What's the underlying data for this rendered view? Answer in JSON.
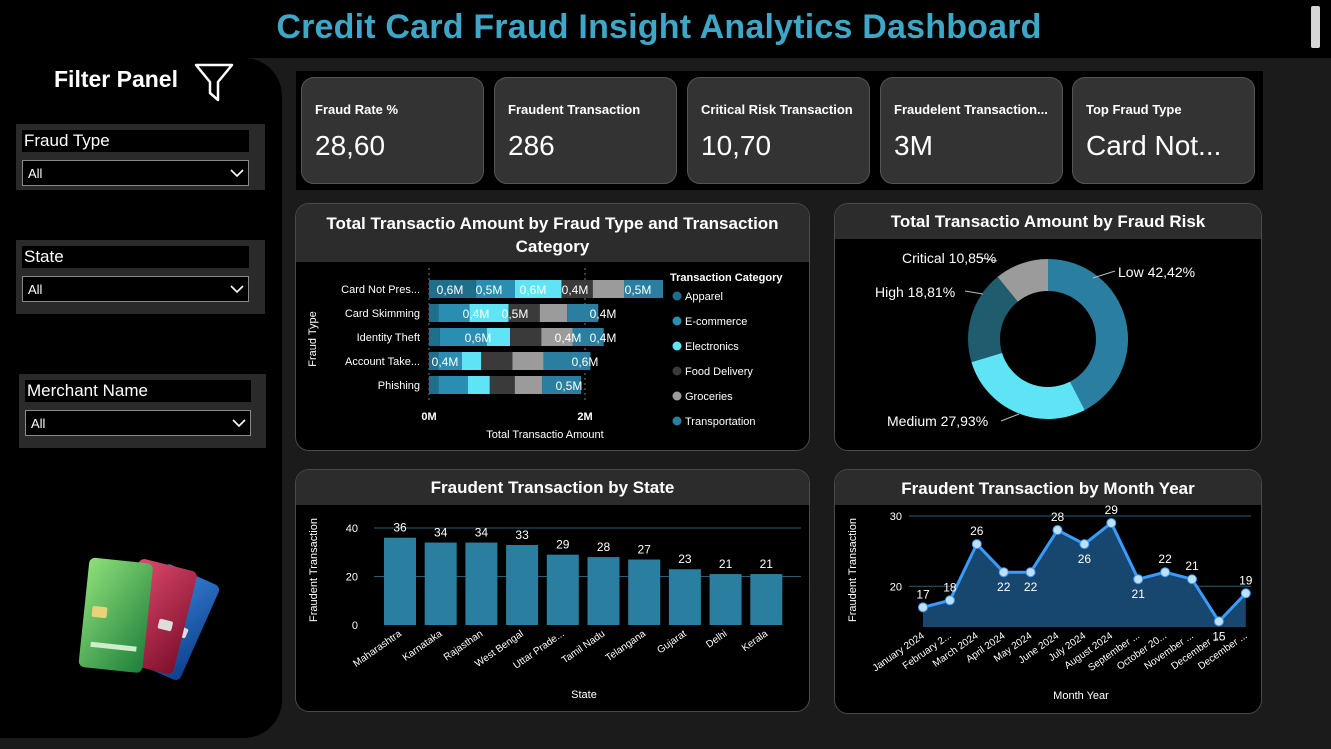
{
  "header": {
    "title": "Credit Card Fraud Insight Analytics Dashboard"
  },
  "filter_panel": {
    "title": "Filter Panel",
    "slicers": [
      {
        "label": "Fraud Type",
        "value": "All"
      },
      {
        "label": "State",
        "value": "All"
      },
      {
        "label": "Merchant Name",
        "value": "All"
      }
    ]
  },
  "kpis": [
    {
      "label": "Fraud Rate %",
      "value": "28,60"
    },
    {
      "label": "Fraudent Transaction",
      "value": "286"
    },
    {
      "label": "Critical Risk Transaction",
      "value": "10,70"
    },
    {
      "label": "Fraudelent Transaction...",
      "value": "3M"
    },
    {
      "label": "Top Fraud Type",
      "value": "Card Not..."
    }
  ],
  "stacked_chart": {
    "title_line1": "Total Transactio Amount by Fraud Type and Transaction",
    "title_line2": "Category",
    "ylabel": "Fraud Type",
    "xlabel": "Total Transactio Amount",
    "ticks": [
      "0M",
      "2M"
    ],
    "legend_title": "Transaction Category",
    "segment_labels": {
      "card_not_present": [
        "0,6M",
        "0,5M",
        "0,6M",
        "0,4M",
        "0,5M"
      ],
      "card_skimming": [
        "0,4M",
        "0,5M",
        "0,4M"
      ],
      "identity_theft": [
        "0,6M",
        "0,4M",
        "0,4M"
      ],
      "account_takeover": [
        "0,4M",
        "0,6M"
      ],
      "phishing": [
        "0,5M"
      ]
    }
  },
  "donut_chart": {
    "title": "Total Transactio Amount by Fraud Risk",
    "labels": [
      "Low 42,42%",
      "Medium 27,93%",
      "High 18,81%",
      "Critical 10,85%"
    ]
  },
  "state_chart": {
    "title": "Fraudent Transaction by State",
    "ylabel": "Fraudent Transaction",
    "xlabel": "State"
  },
  "month_chart": {
    "title": "Fraudent Transaction by Month Year",
    "ylabel": "Fraudent Transaction",
    "xlabel": "Month Year"
  },
  "colors": {
    "title": "#3ea6c6",
    "apparel": "#1f6f8b",
    "ecommerce": "#2a8db2",
    "electronics": "#5ee4f4",
    "food_delivery": "#3a3a3a",
    "groceries": "#9b9b9b",
    "transportation": "#2a7fa0",
    "risk_low": "#2a7fa0",
    "risk_medium": "#5ee4f4",
    "risk_high": "#1f5c6e",
    "risk_critical": "#9b9b9b",
    "state_bar": "#2a7fa0",
    "line": "#3a9bff",
    "area": "#17466e"
  },
  "chart_data": [
    {
      "type": "bar",
      "orientation": "horizontal-stacked",
      "title": "Total Transactio Amount by Fraud Type and Transaction Category",
      "xlabel": "Total Transactio Amount",
      "ylabel": "Fraud Type",
      "categories": [
        "Card Not Pres...",
        "Card Skimming",
        "Identity Theft",
        "Account Take...",
        "Phishing"
      ],
      "series": [
        {
          "name": "Apparel",
          "values": [
            0.6,
            0.12,
            0.14,
            0.12,
            0.12
          ]
        },
        {
          "name": "E-commerce",
          "values": [
            0.5,
            0.4,
            0.6,
            0.3,
            0.38
          ]
        },
        {
          "name": "Electronics",
          "values": [
            0.6,
            0.5,
            0.3,
            0.25,
            0.28
          ]
        },
        {
          "name": "Food Delivery",
          "values": [
            0.4,
            0.4,
            0.4,
            0.4,
            0.32
          ]
        },
        {
          "name": "Groceries",
          "values": [
            0.4,
            0.35,
            0.4,
            0.4,
            0.35
          ]
        },
        {
          "name": "Transportation",
          "values": [
            0.5,
            0.4,
            0.4,
            0.6,
            0.5
          ]
        }
      ],
      "xlim": [
        0,
        2.5
      ],
      "xticks": [
        "0M",
        "2M"
      ],
      "legend_position": "right"
    },
    {
      "type": "pie",
      "variant": "donut",
      "title": "Total Transactio Amount by Fraud Risk",
      "categories": [
        "Low",
        "Medium",
        "High",
        "Critical"
      ],
      "values": [
        42.42,
        27.93,
        18.81,
        10.85
      ]
    },
    {
      "type": "bar",
      "title": "Fraudent Transaction by State",
      "xlabel": "State",
      "ylabel": "Fraudent Transaction",
      "categories": [
        "Maharashtra",
        "Karnataka",
        "Rajasthan",
        "West Bengal",
        "Uttar Prade...",
        "Tamil Nadu",
        "Telangana",
        "Gujarat",
        "Delhi",
        "Kerala"
      ],
      "values": [
        36,
        34,
        34,
        33,
        29,
        28,
        27,
        23,
        21,
        21
      ],
      "ylim": [
        0,
        45
      ],
      "yticks": [
        0,
        20,
        40
      ]
    },
    {
      "type": "area",
      "title": "Fraudent Transaction by Month Year",
      "xlabel": "Month Year",
      "ylabel": "Fraudent Transaction",
      "categories": [
        "January 2024",
        "February 2...",
        "March 2024",
        "April 2024",
        "May 2024",
        "June 2024",
        "July 2024",
        "August 2024",
        "September ...",
        "October 20...",
        "November ...",
        "December ...",
        "December ..."
      ],
      "values": [
        17,
        18,
        26,
        22,
        22,
        28,
        26,
        29,
        21,
        22,
        21,
        15,
        19
      ],
      "ylim": [
        14.2,
        30
      ],
      "yticks": [
        20,
        30
      ]
    }
  ]
}
